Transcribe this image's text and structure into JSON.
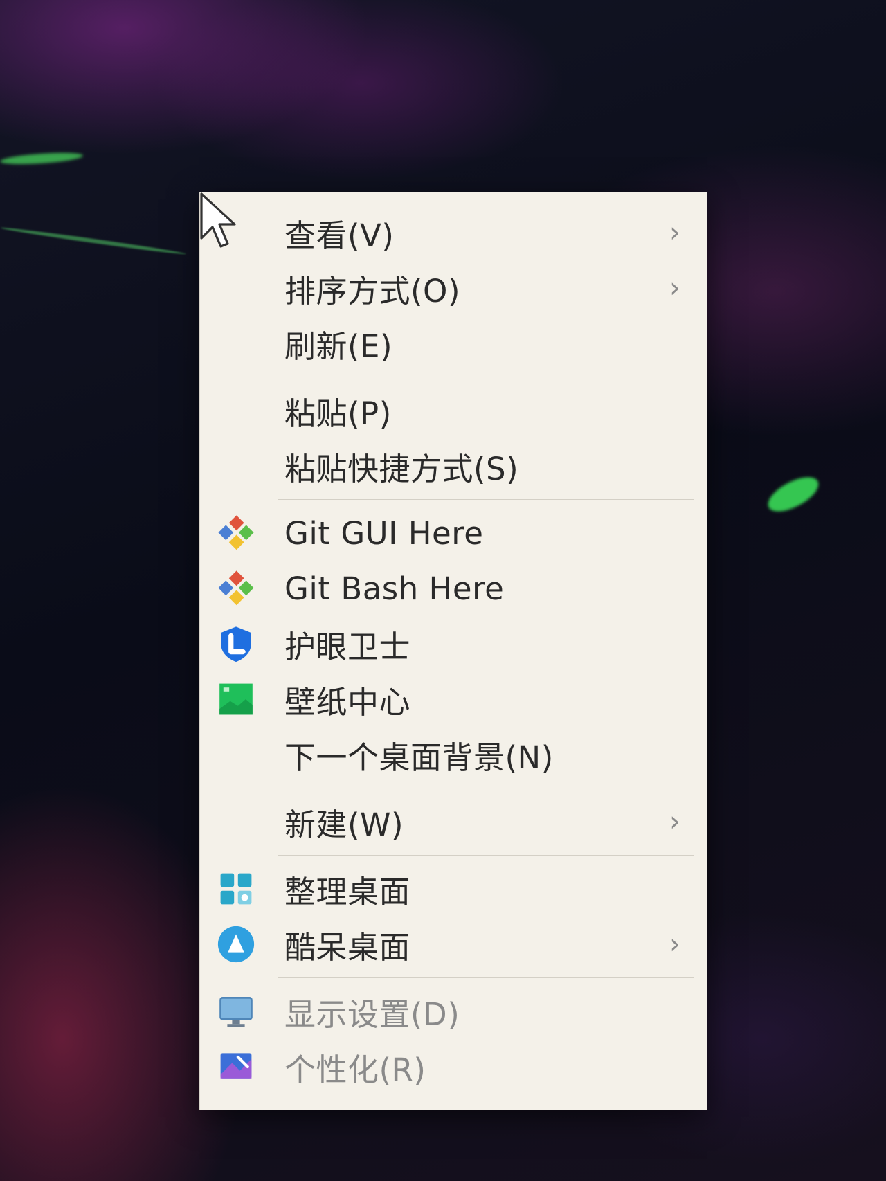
{
  "context_menu": {
    "items": [
      {
        "label": "查看(V)",
        "submenu": true
      },
      {
        "label": "排序方式(O)",
        "submenu": true
      },
      {
        "label": "刷新(E)"
      },
      {
        "label": "粘贴(P)"
      },
      {
        "label": "粘贴快捷方式(S)"
      },
      {
        "label": "Git GUI Here",
        "icon": "git-icon"
      },
      {
        "label": "Git Bash Here",
        "icon": "git-icon"
      },
      {
        "label": "护眼卫士",
        "icon": "eye-guard-icon"
      },
      {
        "label": "壁纸中心",
        "icon": "wallpaper-icon"
      },
      {
        "label": "下一个桌面背景(N)"
      },
      {
        "label": "新建(W)",
        "submenu": true
      },
      {
        "label": "整理桌面",
        "icon": "organize-desktop-icon"
      },
      {
        "label": "酷呆桌面",
        "icon": "kudai-desktop-icon",
        "submenu": true
      },
      {
        "label": "显示设置(D)",
        "icon": "display-settings-icon"
      },
      {
        "label": "个性化(R)",
        "icon": "personalize-icon"
      }
    ],
    "submenu_arrow": "›"
  },
  "colors": {
    "menu_background": "#f4f1e9",
    "git_red": "#e0533c",
    "git_green": "#5bbf4a",
    "git_blue": "#4a7fd4",
    "git_yellow": "#f2c230",
    "eye_guard_blue": "#1f6fe0",
    "wallpaper_green": "#1fbf5a",
    "organize_teal": "#2aa7c9",
    "kudai_blue": "#2fa0e0"
  }
}
